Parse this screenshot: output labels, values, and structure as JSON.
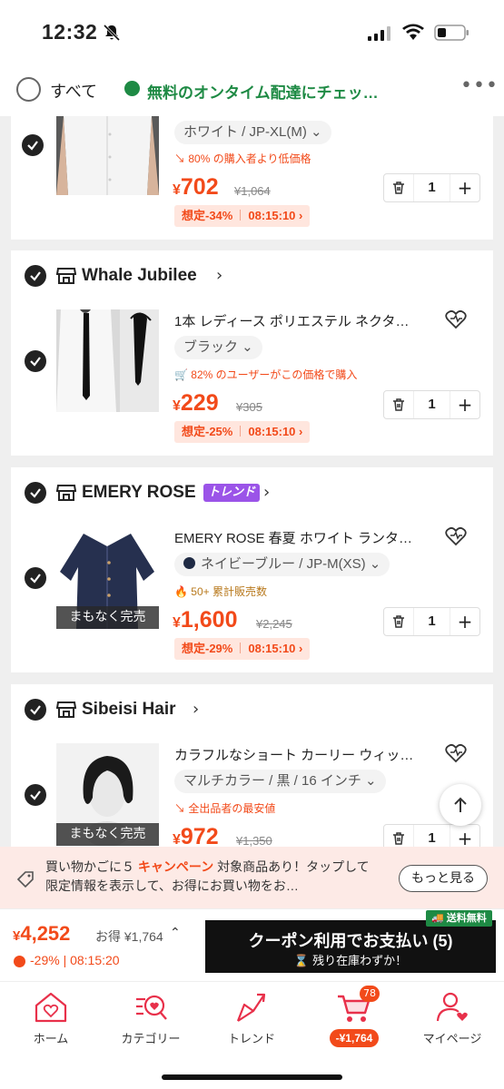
{
  "status_bar": {
    "time": "12:32"
  },
  "header": {
    "select_all_label": "すべて",
    "promo_text": "無料のオンタイム配達にチェッ…"
  },
  "items": [
    {
      "variant": "ホワイト / JP-XL(M)",
      "hint": "80% の購入者より低価格",
      "price_symbol": "¥",
      "price": "702",
      "old_price": "¥1,064",
      "discount": "想定-34%",
      "timer": "08:15:10",
      "qty": "1"
    },
    {
      "store": "Whale Jubilee",
      "title": "1本 レディース ポリエステル ネクタ…",
      "variant": "ブラック",
      "hint": "82% のユーザーがこの価格で購入",
      "price_symbol": "¥",
      "price": "229",
      "old_price": "¥305",
      "discount": "想定-25%",
      "timer": "08:15:10",
      "qty": "1"
    },
    {
      "store": "EMERY ROSE",
      "badge": "トレンド",
      "title": "EMERY ROSE 春夏 ホワイト ランタ…",
      "variant": "ネイビーブルー / JP-M(XS)",
      "hint": "50+ 累計販売数",
      "soon_label": "まもなく完売",
      "price_symbol": "¥",
      "price": "1,600",
      "old_price": "¥2,245",
      "discount": "想定-29%",
      "timer": "08:15:10",
      "qty": "1"
    },
    {
      "store": "Sibeisi Hair",
      "title": "カラフルなショート カーリー ウィッ…",
      "variant": "マルチカラー / 黒 / 16 インチ",
      "hint": "全出品者の最安値",
      "soon_label": "まもなく完売",
      "price_symbol": "¥",
      "price": "972",
      "old_price": "¥1,350",
      "qty": "1"
    }
  ],
  "banner": {
    "text_a": "買い物かごに５ ",
    "text_hl": "キャンペーン",
    "text_b": " 対象商品あり！タップして限定情報を表示して、お得にお買い物をお…",
    "button": "もっと見る"
  },
  "checkout": {
    "total_symbol": "¥",
    "total": "4,252",
    "saved": "お得 ¥1,764",
    "sub": "-29% | 08:15:20",
    "pay_label": "クーポン利用でお支払い (5)",
    "pay_sub": "残り在庫わずか！",
    "free_shipping": "送料無料"
  },
  "tabs": {
    "home": "ホーム",
    "category": "カテゴリー",
    "trend": "トレンド",
    "cart_badge": "78",
    "cart_price": "-¥1,764",
    "mypage": "マイページ"
  },
  "colors": {
    "accent": "#f24a1a",
    "green": "#1e8a44",
    "trend": "#9b54e8"
  }
}
